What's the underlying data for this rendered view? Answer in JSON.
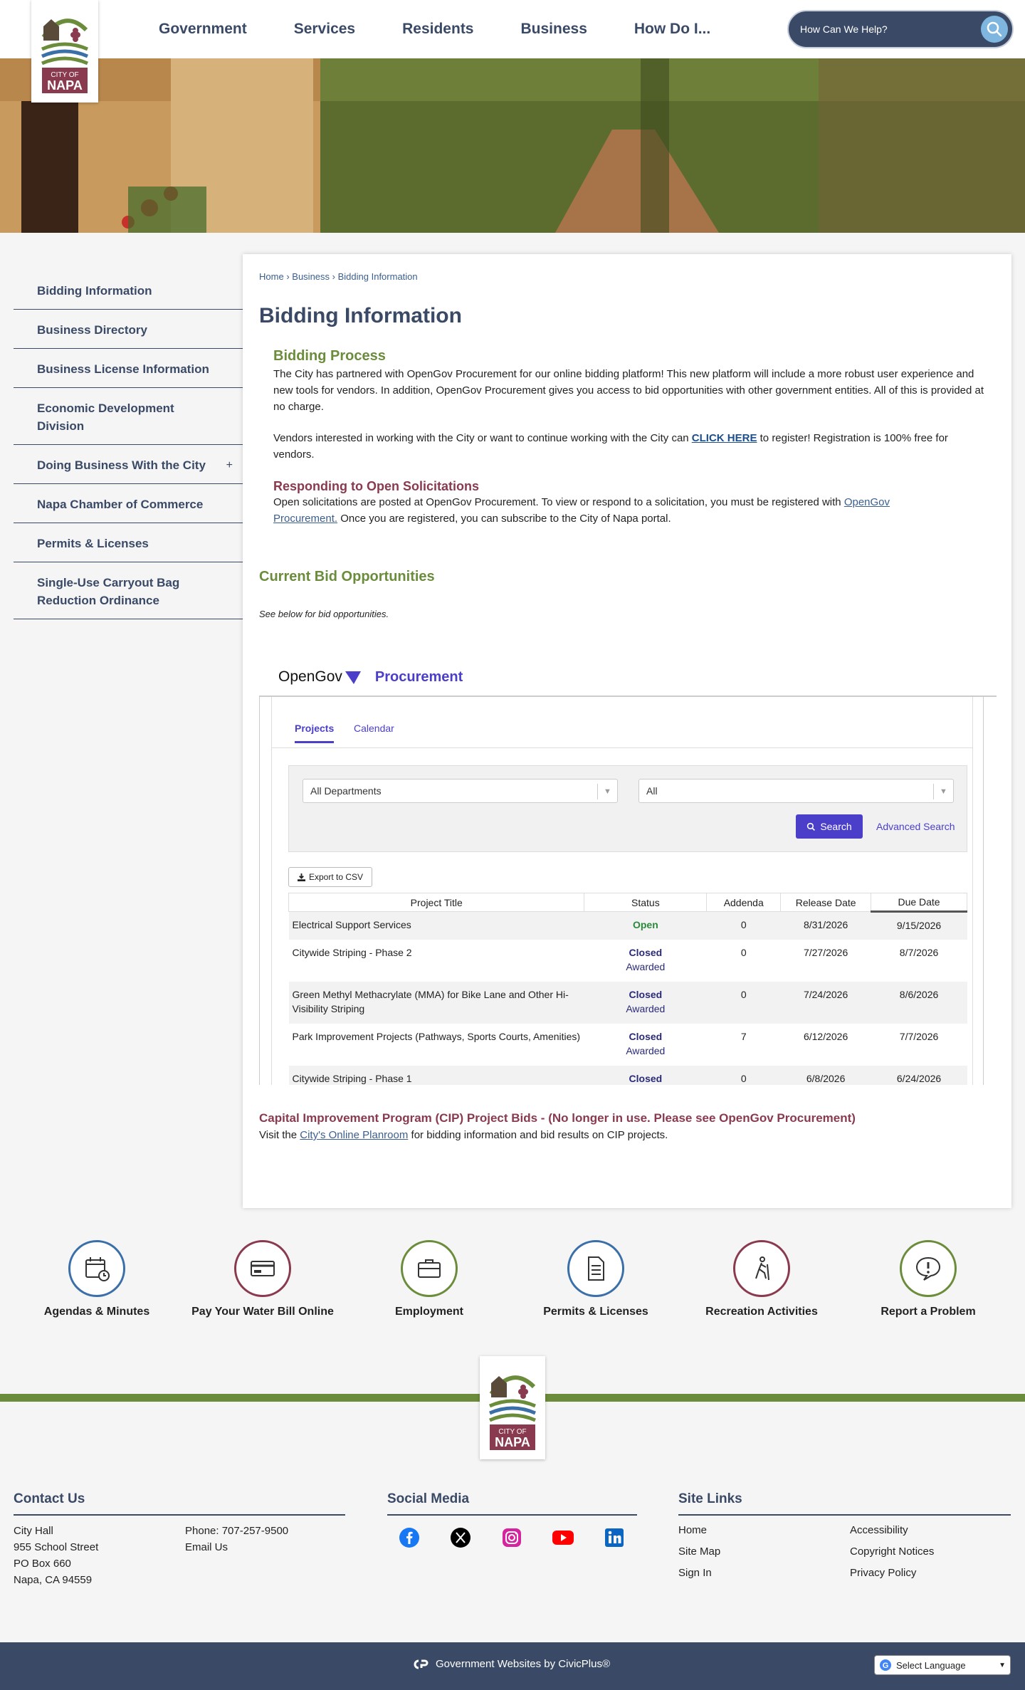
{
  "header": {
    "logo_text_top": "CITY OF",
    "logo_text_bottom": "NAPA",
    "nav": [
      "Government",
      "Services",
      "Residents",
      "Business",
      "How Do I..."
    ],
    "search_placeholder": "How Can We Help?"
  },
  "sidebar": {
    "items": [
      {
        "label": "Bidding Information"
      },
      {
        "label": "Business Directory"
      },
      {
        "label": "Business License Information"
      },
      {
        "label": "Economic Development Division"
      },
      {
        "label": "Doing Business With the City",
        "expander": "+"
      },
      {
        "label": "Napa Chamber of Commerce"
      },
      {
        "label": "Permits & Licenses"
      },
      {
        "label": "Single-Use Carryout Bag Reduction Ordinance"
      }
    ]
  },
  "breadcrumb": {
    "home": "Home",
    "sep": "›",
    "business": "Business",
    "current": "Bidding Information"
  },
  "page_title": "Bidding Information",
  "bidding_process": {
    "heading": "Bidding Process",
    "p1": "The City has partnered with OpenGov Procurement for our online bidding platform! This new platform will include a more robust user experience and new tools for vendors. In addition, OpenGov Procurement gives you access to bid opportunities with other government entities. All of this is provided at no charge.",
    "p2_before": "Vendors interested in working with the City or want to continue working with the City can ",
    "p2_link": "CLICK HERE",
    "p2_after": " to register! Registration is 100% free for vendors."
  },
  "responding": {
    "heading": "Responding to Open Solicitations",
    "before": "Open solicitations are posted at OpenGov Procurement.  To view or respond to a solicitation, you must be registered with ",
    "link": "OpenGov Procurement.",
    "after": " Once you are registered, you can subscribe to the City of Napa portal."
  },
  "current_bids": {
    "heading": "Current Bid Opportunities",
    "note": "See below for bid opportunities."
  },
  "opengov": {
    "brand": "OpenGov",
    "product": "Procurement",
    "tabs": [
      "Projects",
      "Calendar"
    ],
    "filter_department": "All Departments",
    "filter_status": "All",
    "search_label": "Search",
    "advanced_search": "Advanced Search",
    "export_label": "Export to CSV",
    "columns": [
      "Project Title",
      "Status",
      "Addenda",
      "Release Date",
      "Due Date"
    ],
    "rows": [
      {
        "title": "Electrical Support Services",
        "status": "Open",
        "sub": "",
        "addenda": "0",
        "release": "8/31/2026",
        "due": "9/15/2026"
      },
      {
        "title": "Citywide Striping - Phase 2",
        "status": "Closed",
        "sub": "Awarded",
        "addenda": "0",
        "release": "7/27/2026",
        "due": "8/7/2026"
      },
      {
        "title": "Green Methyl Methacrylate (MMA) for Bike Lane and Other Hi-Visibility Striping",
        "status": "Closed",
        "sub": "Awarded",
        "addenda": "0",
        "release": "7/24/2026",
        "due": "8/6/2026"
      },
      {
        "title": "Park Improvement Projects (Pathways, Sports Courts, Amenities)",
        "status": "Closed",
        "sub": "Awarded",
        "addenda": "7",
        "release": "6/12/2026",
        "due": "7/7/2026"
      },
      {
        "title": "Citywide Striping - Phase 1",
        "status": "Closed",
        "sub": "",
        "addenda": "0",
        "release": "6/8/2026",
        "due": "6/24/2026"
      }
    ]
  },
  "cip": {
    "heading": "Capital Improvement Program (CIP) Project Bids - (No longer in use. Please see OpenGov Procurement)",
    "before": "Visit the ",
    "link": "City's Online Planroom",
    "after": " for bidding information and bid results on CIP projects."
  },
  "quick_links": [
    {
      "label": "Agendas & Minutes",
      "icon": "calendar-clock-icon",
      "color": "#3a6fa8"
    },
    {
      "label": "Pay Your Water Bill Online",
      "icon": "credit-card-icon",
      "color": "#8a3a4e"
    },
    {
      "label": "Employment",
      "icon": "briefcase-icon",
      "color": "#6b8c3b"
    },
    {
      "label": "Permits & Licenses",
      "icon": "document-icon",
      "color": "#3a6fa8"
    },
    {
      "label": "Recreation Activities",
      "icon": "hiker-icon",
      "color": "#8a3a4e"
    },
    {
      "label": "Report a Problem",
      "icon": "alert-bubble-icon",
      "color": "#6b8c3b"
    }
  ],
  "footer": {
    "contact": {
      "heading": "Contact Us",
      "address": [
        "City Hall",
        "955 School Street",
        "PO Box 660",
        "Napa, CA 94559"
      ],
      "phone": "Phone: 707-257-9500",
      "email": "Email Us"
    },
    "social": {
      "heading": "Social Media",
      "icons": [
        "facebook-icon",
        "x-icon",
        "instagram-icon",
        "youtube-icon",
        "linkedin-icon"
      ]
    },
    "site_links": {
      "heading": "Site Links",
      "col1": [
        "Home",
        "Site Map",
        "Sign In"
      ],
      "col2": [
        "Accessibility",
        "Copyright Notices",
        "Privacy Policy"
      ]
    },
    "civicplus": "Government Websites by CivicPlus®",
    "language": "Select Language"
  }
}
